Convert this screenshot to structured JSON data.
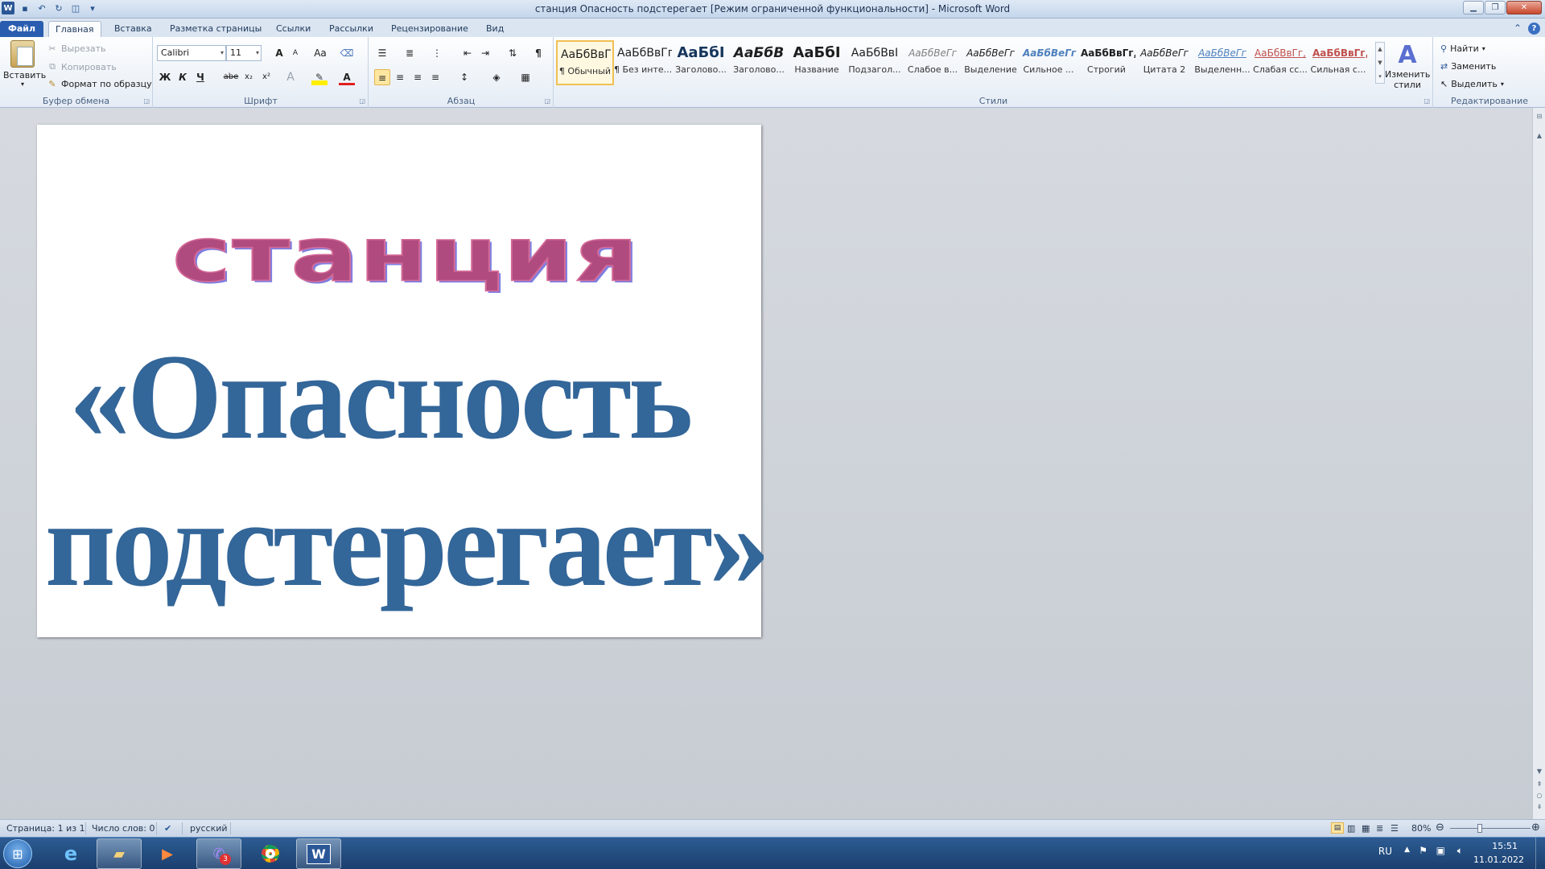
{
  "window": {
    "title": "станция Опасность подстерегает [Режим ограниченной функциональности]  -  Microsoft Word"
  },
  "qat": {
    "app_icon": "W"
  },
  "tabs": [
    "Файл",
    "Главная",
    "Вставка",
    "Разметка страницы",
    "Ссылки",
    "Рассылки",
    "Рецензирование",
    "Вид"
  ],
  "clipboard": {
    "paste": "Вставить",
    "cut": "Вырезать",
    "copy": "Копировать",
    "format_painter": "Формат по образцу",
    "label": "Буфер обмена"
  },
  "font": {
    "name": "Calibri",
    "size": "11",
    "label": "Шрифт",
    "bold": "Ж",
    "italic": "К",
    "underline": "Ч",
    "strike": "abe",
    "subscript": "x₂",
    "superscript": "x²",
    "grow": "A",
    "shrink": "A",
    "case": "Aa"
  },
  "paragraph": {
    "label": "Абзац"
  },
  "styles": {
    "label": "Стили",
    "items": [
      {
        "preview": "АаБбВвГг,",
        "name": "¶ Обычный"
      },
      {
        "preview": "АаБбВвГг,",
        "name": "¶ Без инте..."
      },
      {
        "preview": "АаБбІ",
        "name": "Заголово..."
      },
      {
        "preview": "АаБбВ",
        "name": "Заголово..."
      },
      {
        "preview": "АаБбІ",
        "name": "Название"
      },
      {
        "preview": "АаБбВвІ",
        "name": "Подзагол..."
      },
      {
        "preview": "АаБбВеГг",
        "name": "Слабое в..."
      },
      {
        "preview": "АаБбВеГг",
        "name": "Выделение"
      },
      {
        "preview": "АаБбВеГг",
        "name": "Сильное ..."
      },
      {
        "preview": "АаБбВвГг,",
        "name": "Строгий"
      },
      {
        "preview": "АаБбВеГг",
        "name": "Цитата 2"
      },
      {
        "preview": "АаБбВеГг",
        "name": "Выделенн..."
      },
      {
        "preview": "АаБбВвГг,",
        "name": "Слабая сс..."
      },
      {
        "preview": "АаБбВвГг,",
        "name": "Сильная с..."
      }
    ],
    "change": "Изменить стили"
  },
  "editing": {
    "find": "Найти",
    "replace": "Заменить",
    "select": "Выделить",
    "label": "Редактирование"
  },
  "document": {
    "line1": "станция",
    "line2": "«Опасность",
    "line3": "подстерегает»"
  },
  "status": {
    "page": "Страница: 1 из 1",
    "words": "Число слов: 0",
    "language": "русский",
    "zoom": "80%"
  },
  "tray": {
    "lang": "RU",
    "time": "15:51",
    "date": "11.01.2022",
    "viber_badge": "3"
  }
}
